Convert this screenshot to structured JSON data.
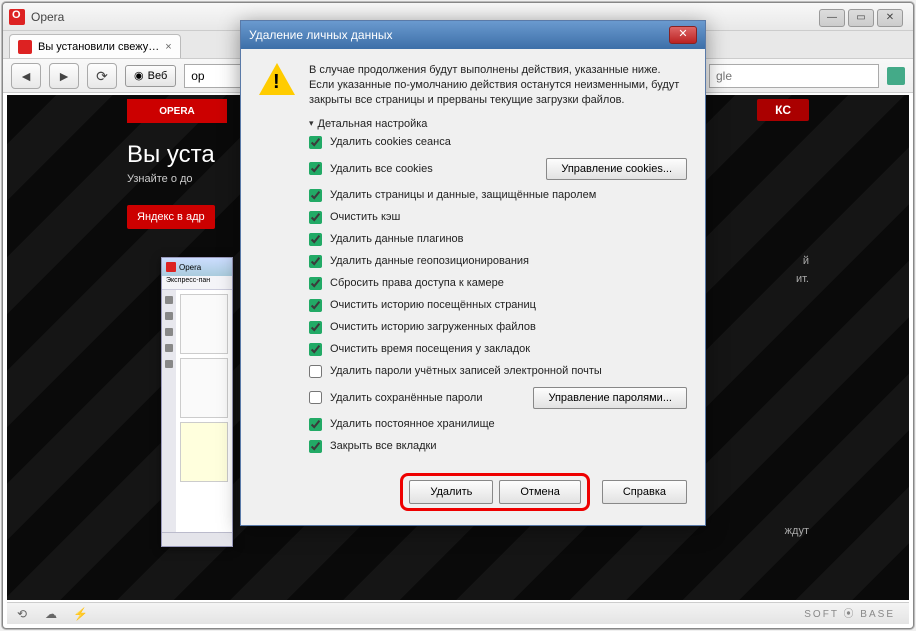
{
  "app": {
    "title": "Opera"
  },
  "win_controls": {
    "min": "—",
    "max": "▭",
    "close": "✕"
  },
  "tab": {
    "label": "Вы установили свежу…",
    "close": "×"
  },
  "toolbar": {
    "back": "◄",
    "fwd": "►",
    "reload": "⟳",
    "web_btn": "Веб",
    "addr_value": "op",
    "search_placeholder": "gle"
  },
  "page": {
    "logo": "OPERA",
    "hero": "Вы уста",
    "sub": "Узнайте о до",
    "yandex_btn": "Яндекс в адр",
    "badge": "КС",
    "side_frag1": "й",
    "side_frag2": "ит.",
    "side_frag3": "ждут"
  },
  "mini": {
    "title": "Opera",
    "tab": "Экспресс-пан"
  },
  "dialog": {
    "title": "Удаление личных данных",
    "msg": "В случае продолжения будут выполнены действия, указанные ниже. Если указанные по-умолчанию действия останутся неизменными, будут закрыты все страницы и прерваны текущие загрузки файлов.",
    "disclosure": "Детальная настройка",
    "cookies_mgmt": "Управление cookies...",
    "passwords_mgmt": "Управление паролями...",
    "options": [
      {
        "label": "Удалить cookies сеанса",
        "checked": true
      },
      {
        "label": "Удалить все cookies",
        "checked": true
      },
      {
        "label": "Удалить страницы и данные, защищённые паролем",
        "checked": true
      },
      {
        "label": "Очистить кэш",
        "checked": true
      },
      {
        "label": "Удалить данные плагинов",
        "checked": true
      },
      {
        "label": "Удалить данные геопозиционирования",
        "checked": true
      },
      {
        "label": "Сбросить права доступа к камере",
        "checked": true
      },
      {
        "label": "Очистить историю посещённых страниц",
        "checked": true
      },
      {
        "label": "Очистить историю загруженных файлов",
        "checked": true
      },
      {
        "label": "Очистить время посещения у закладок",
        "checked": true
      },
      {
        "label": "Удалить пароли учётных записей электронной почты",
        "checked": false
      },
      {
        "label": "Удалить сохранённые пароли",
        "checked": false
      },
      {
        "label": "Удалить постоянное хранилище",
        "checked": true
      },
      {
        "label": "Закрыть все вкладки",
        "checked": true
      }
    ],
    "btn_delete": "Удалить",
    "btn_cancel": "Отмена",
    "btn_help": "Справка"
  },
  "watermark": "SOFT ⦿ BASE"
}
